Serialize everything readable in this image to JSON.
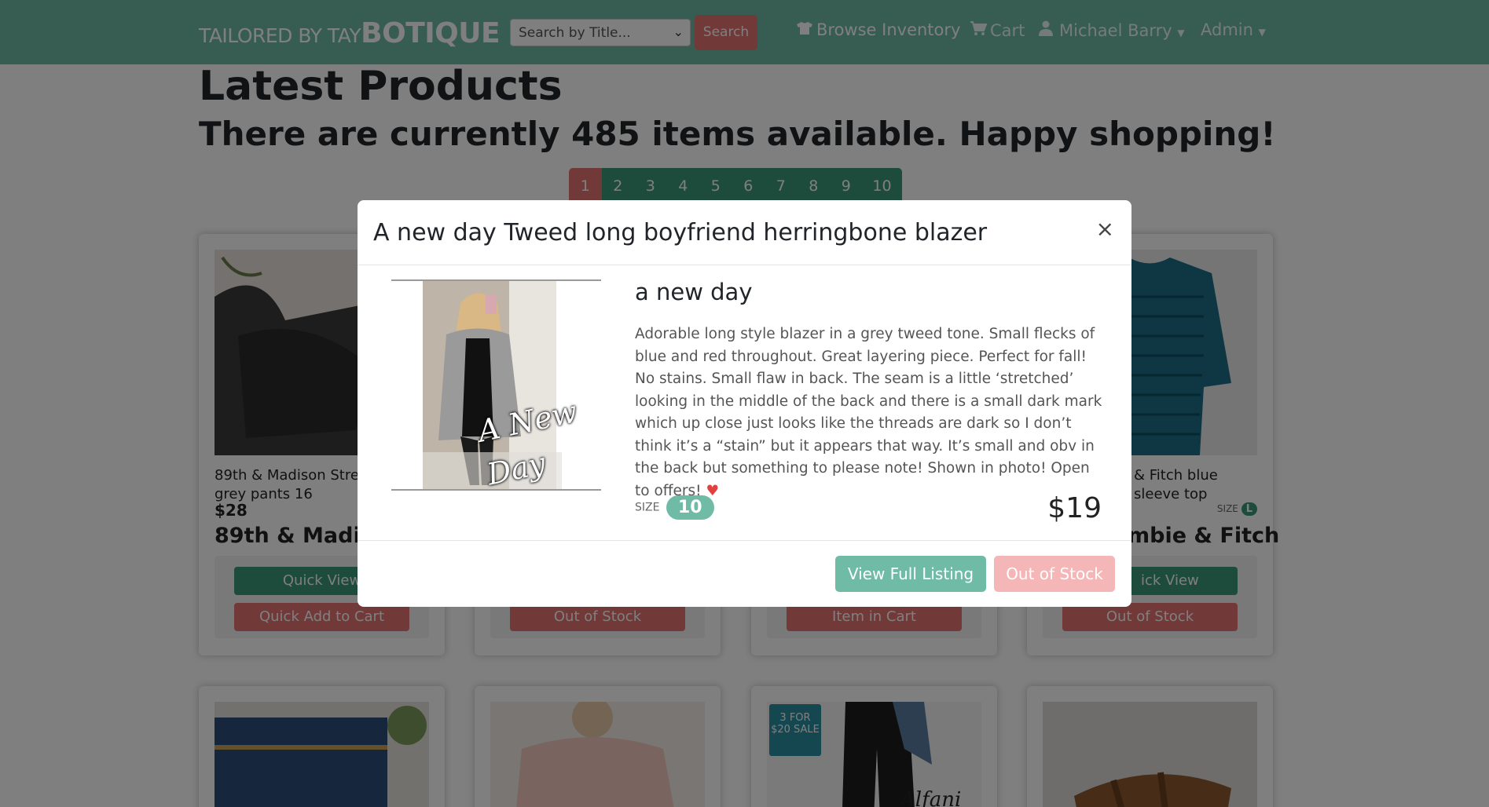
{
  "navbar": {
    "brand_light": "TAILORED BY TAY",
    "brand_bold": "BOTIQUE",
    "search_placeholder": "Search by Title...",
    "search_button": "Search",
    "browse": "Browse Inventory",
    "cart": "Cart",
    "user": "Michael Barry",
    "admin": "Admin"
  },
  "page": {
    "title": "Latest Products",
    "subtitle": "There are currently 485 items available. Happy shopping!"
  },
  "pagination": [
    "1",
    "2",
    "3",
    "4",
    "5",
    "6",
    "7",
    "8",
    "9",
    "10"
  ],
  "cards": [
    {
      "title": "89th & Madison Stretch waist grey pants 16",
      "price": "$28",
      "brand": "89th & Madison",
      "btn1": "Quick View",
      "btn2": "Quick Add to Cart"
    },
    {
      "btn2": "Out of Stock"
    },
    {
      "btn2": "Item in Cart"
    },
    {
      "title": "& Fitch blue sleeve top",
      "size_label": "SIZE",
      "size": "L",
      "brand": "mbie & Fitch",
      "btn1": "ick View",
      "btn2": "Out of Stock"
    }
  ],
  "modal": {
    "title": "A new day Tweed long boyfriend herringbone blazer",
    "close": "×",
    "brand": "a new day",
    "description": "Adorable long style blazer in a grey tweed tone. Small flecks of blue and red throughout. Great layering piece. Perfect for fall! No stains. Small flaw in back. The seam is a little ‘stretched’ looking in the middle of the back and there is a small dark mark which up close just looks like the threads are dark so I don’t think it’s a “stain” but it appears that way. It’s small and obv in the back but something to please note! Shown in photo! Open to offers!",
    "size_label": "SIZE",
    "size": "10",
    "price": "$19",
    "btn_full": "View Full Listing",
    "btn_oos": "Out of Stock",
    "image_caption": "A New Day"
  },
  "overlays": {
    "badge_line1": "3 FOR",
    "badge_line2": "$20 SALE",
    "brand_script": "Alfani"
  },
  "colors": {
    "nav_green": "#6fbba5",
    "dark_green": "#3a9678",
    "red": "#e57373",
    "light_red": "#f4b6b6"
  }
}
